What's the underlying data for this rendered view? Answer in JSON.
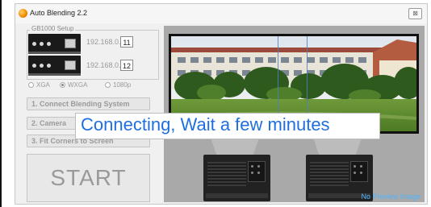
{
  "window": {
    "title": "Auto Blending 2.2",
    "close_glyph": "⊠"
  },
  "setup": {
    "group_label": "GB1000 Setup",
    "devices": [
      {
        "ip_prefix": "192.168.0.",
        "ip_last": "11"
      },
      {
        "ip_prefix": "192.168.0.",
        "ip_last": "12"
      }
    ]
  },
  "resolutions": {
    "options": [
      "XGA",
      "WXGA",
      "1080p"
    ],
    "selected": "WXGA"
  },
  "steps": {
    "connect": "1. Connect Blending System",
    "camera": "2. Camera",
    "fit": "3. Fit Corners to Screen"
  },
  "start_label": "START",
  "preview": {
    "status": "No Preview Image"
  },
  "overlay": {
    "message": "Connecting, Wait a few minutes"
  },
  "colors": {
    "overlay_text": "#1e6fe0",
    "preview_status": "#4db5ff",
    "blend_line": "#4e7fc2"
  }
}
